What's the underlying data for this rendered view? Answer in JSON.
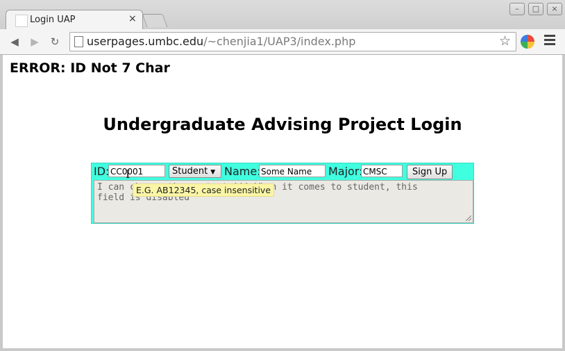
{
  "browser": {
    "tab_title": "Login UAP",
    "tab_close": "×",
    "url_host": "userpages.umbc.edu",
    "url_path": "/~chenjia1/UAP3/index.php"
  },
  "page": {
    "error": "ERROR: ID Not 7 Char",
    "heading": "Undergraduate Advising Project Login"
  },
  "form": {
    "id_label": "ID:",
    "id_value": "CC0001",
    "role_selected": "Student",
    "name_label": "Name:",
    "name_value": "Some Name",
    "major_label": "Major:",
    "major_value": "CMSC",
    "signup_label": "Sign Up",
    "textarea_line1": "I can change the contents!!! When it comes to student, this",
    "textarea_line2": "field is disabled"
  },
  "tooltip": "E.G. AB12345, case insensitive"
}
